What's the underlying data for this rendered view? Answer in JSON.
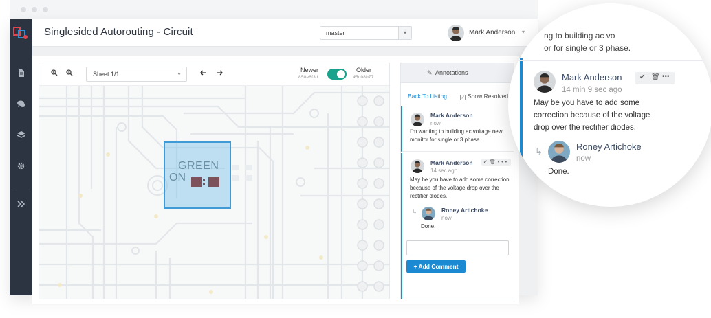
{
  "app": {
    "title": "Singlesided Autorouting - Circuit",
    "branch": "master",
    "user_name": "Mark Anderson"
  },
  "toolbar": {
    "sheet": "Sheet  1/1",
    "newer_label": "Newer",
    "newer_hash": "850e8f3d",
    "older_label": "Older",
    "older_hash": "45d08b77"
  },
  "pcb": {
    "selection_text_1": "GREEN",
    "selection_text_2": "ON"
  },
  "annotations": {
    "title": "Annotations",
    "back_link": "Back To Listing",
    "show_resolved": "Show Resolved",
    "threads": [
      {
        "author": "Mark Anderson",
        "time": "now",
        "body": "I'm wanting to building ac voltage new monitor for single or 3 phase."
      },
      {
        "author": "Mark Anderson",
        "time": "14 sec ago",
        "body": "May be you have to add some correction because of the voltage drop over the rectifier diodes.",
        "reply": {
          "author": "Roney Artichoke",
          "time": "now",
          "body": "Done."
        }
      }
    ],
    "add_comment": "+ Add Comment"
  },
  "magnifier": {
    "top_text_1": "ng to building ac vo",
    "top_text_2": "or for single or 3 phase.",
    "author": "Mark Anderson",
    "time": "14 min 9 sec ago",
    "body_1": "May be you have to add some",
    "body_2": "correction because of the voltage",
    "body_3": "drop over the rectifier diodes.",
    "reply_author": "Roney Artichoke",
    "reply_time": "now",
    "reply_body": "Done."
  },
  "colors": {
    "accent": "#1b8ad3",
    "toggle": "#19a38c",
    "sidebar": "#2b3440"
  }
}
